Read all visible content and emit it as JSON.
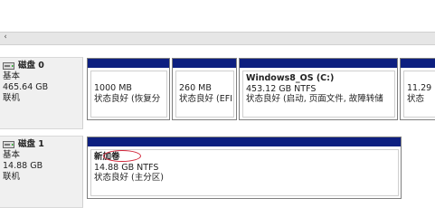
{
  "scrollbar": {
    "left_arrow": "‹"
  },
  "disks": [
    {
      "name": "磁盘 0",
      "type": "基本",
      "size": "465.64 GB",
      "status": "联机",
      "partitions": [
        {
          "volume": "",
          "size": "1000 MB",
          "status": "状态良好 (恢复分"
        },
        {
          "volume": "",
          "size": "260 MB",
          "status": "状态良好 (EFI"
        },
        {
          "volume": "Windows8_OS  (C:)",
          "size": "453.12 GB NTFS",
          "status": "状态良好 (启动, 页面文件, 故障转储"
        },
        {
          "volume": "",
          "size": "11.29 (",
          "status": "状态"
        }
      ]
    },
    {
      "name": "磁盘 1",
      "type": "基本",
      "size": "14.88 GB",
      "status": "联机",
      "partitions": [
        {
          "volume": "新加卷",
          "size": "14.88 GB NTFS",
          "status": "状态良好 (主分区)"
        }
      ]
    }
  ],
  "colors": {
    "primary_partition_bar": "#0d1f80",
    "annotation_circle": "#d2263a"
  }
}
